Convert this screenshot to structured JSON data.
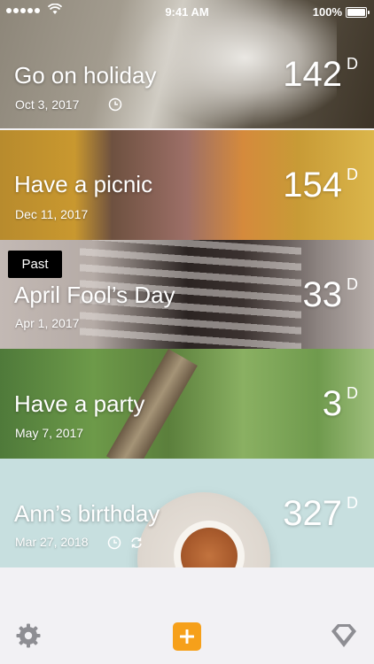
{
  "status_bar": {
    "time": "9:41 AM",
    "battery": "100%"
  },
  "events": [
    {
      "title": "Go on holiday",
      "date": "Oct 3, 2017",
      "days": "142",
      "unit": "D",
      "icons": [
        "clock-icon"
      ]
    },
    {
      "title": "Have a picnic",
      "date": "Dec 11, 2017",
      "days": "154",
      "unit": "D",
      "icons": []
    },
    {
      "title": "April Fool’s Day",
      "date": "Apr 1, 2017",
      "days": "33",
      "unit": "D",
      "badge": "Past",
      "icons": []
    },
    {
      "title": "Have a party",
      "date": "May 7, 2017",
      "days": "3",
      "unit": "D",
      "icons": []
    },
    {
      "title": "Ann’s birthday",
      "date": "Mar 27, 2018",
      "days": "327",
      "unit": "D",
      "icons": [
        "clock-icon",
        "repeat-icon"
      ]
    }
  ],
  "tab_bar": {
    "items": [
      "settings-icon",
      "add-icon",
      "premium-icon"
    ]
  },
  "colors": {
    "accent": "#f6a01a",
    "tab_icon": "#8e8e93"
  }
}
